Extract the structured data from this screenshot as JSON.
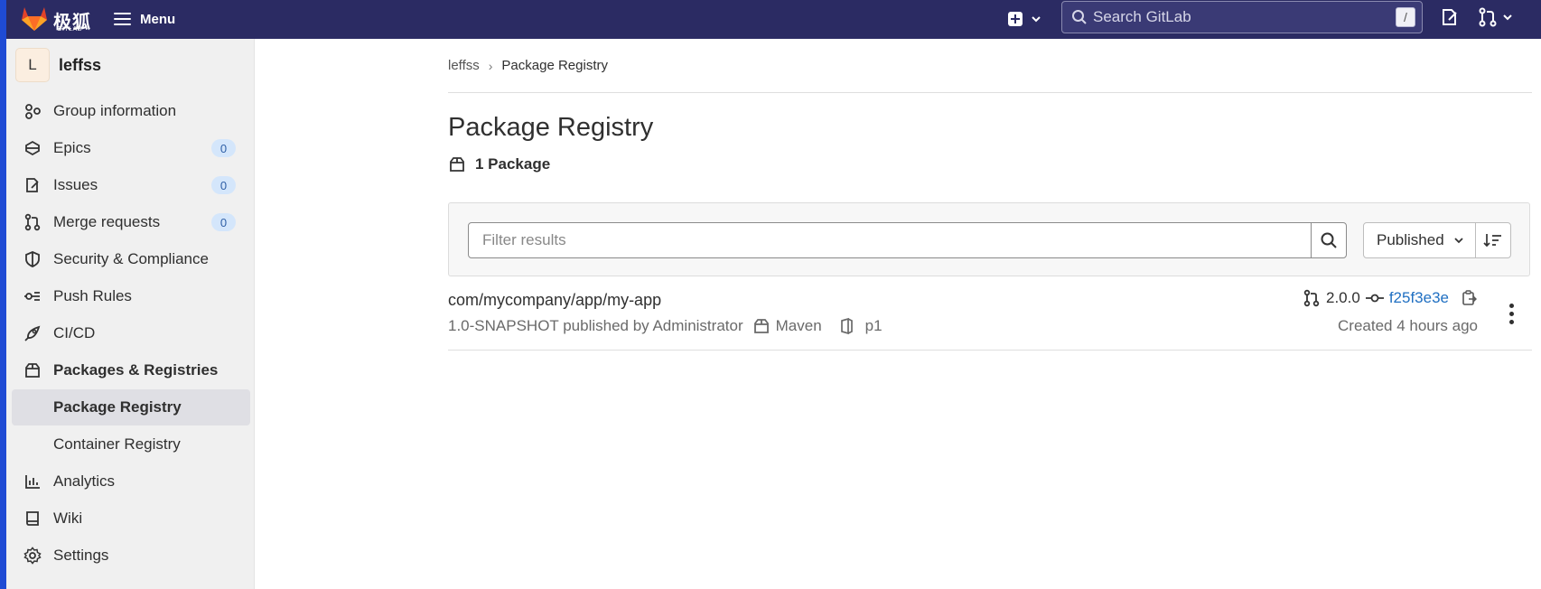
{
  "topbar": {
    "logo_cn": "极狐",
    "logo_en": "GITLAB",
    "menu_label": "Menu",
    "search_placeholder": "Search GitLab",
    "search_shortcut": "/"
  },
  "sidebar": {
    "group_avatar": "L",
    "group_name": "leffss",
    "items": [
      {
        "label": "Group information",
        "icon": "group-info-icon"
      },
      {
        "label": "Epics",
        "icon": "epic-icon",
        "count": "0"
      },
      {
        "label": "Issues",
        "icon": "issues-icon",
        "count": "0"
      },
      {
        "label": "Merge requests",
        "icon": "merge-request-icon",
        "count": "0"
      },
      {
        "label": "Security & Compliance",
        "icon": "shield-icon"
      },
      {
        "label": "Push Rules",
        "icon": "push-rules-icon"
      },
      {
        "label": "CI/CD",
        "icon": "rocket-icon"
      },
      {
        "label": "Packages & Registries",
        "icon": "package-icon"
      },
      {
        "label": "Package Registry"
      },
      {
        "label": "Container Registry"
      },
      {
        "label": "Analytics",
        "icon": "chart-icon"
      },
      {
        "label": "Wiki",
        "icon": "book-icon"
      },
      {
        "label": "Settings",
        "icon": "gear-icon"
      }
    ]
  },
  "breadcrumb": {
    "group": "leffss",
    "current": "Package Registry"
  },
  "main": {
    "title": "Package Registry",
    "package_count": "1 Package",
    "filter_placeholder": "Filter results",
    "sort_label": "Published"
  },
  "package": {
    "name": "com/mycompany/app/my-app",
    "meta": "1.0-SNAPSHOT published by Administrator",
    "type": "Maven",
    "project": "p1",
    "version": "2.0.0",
    "commit": "f25f3e3e",
    "created": "Created 4 hours ago"
  },
  "colors": {
    "topbar": "#2b2b63",
    "accent_link": "#1f6fc2",
    "badge_bg": "#d4e6fb"
  }
}
